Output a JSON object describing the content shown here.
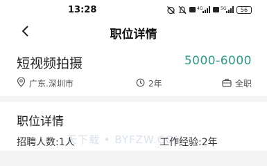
{
  "status_bar": {
    "time": "13:28",
    "battery": "56",
    "icons": [
      "alarm-off-icon",
      "mute-icon",
      "hd-4g-signal-icon",
      "hd-5g-signal-icon",
      "battery-icon"
    ],
    "network_labels": [
      "4G",
      "5G"
    ]
  },
  "nav": {
    "title": "职位详情",
    "back_icon": "chevron-left-icon"
  },
  "job": {
    "title": "短视频拍摄",
    "salary": "5000-6000",
    "salary_color": "#2b9a89",
    "location": "广东.深圳市",
    "experience": "2年",
    "employment_type": "全职"
  },
  "details": {
    "section_title": "职位详情",
    "headcount": "招聘人数:1人",
    "experience": "工作经验:2年"
  },
  "watermark": "天下载 • BYFZW.COM"
}
